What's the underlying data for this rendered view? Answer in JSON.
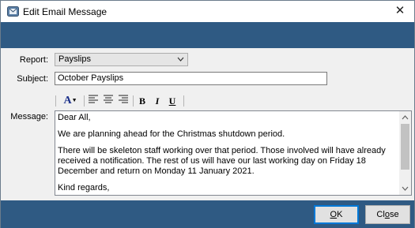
{
  "window": {
    "title": "Edit Email Message"
  },
  "form": {
    "report_label": "Report:",
    "report_value": "Payslips",
    "subject_label": "Subject:",
    "subject_value": "October Payslips",
    "message_label": "Message:"
  },
  "toolbar": {
    "font_color": "A",
    "bold": "B",
    "italic": "I",
    "underline": "U"
  },
  "message": {
    "line1": "Dear All,",
    "line2": "We are planning ahead for the Christmas shutdown period.",
    "line3": "There will be skeleton staff working over that period.  Those involved will have already received a notification.  The rest of us will have our last working day on Friday 18 December and return on Monday 11 January 2021.",
    "line4": "Kind regards,"
  },
  "buttons": {
    "ok_mnemonic": "O",
    "ok_rest": "K",
    "close_pre": "Cl",
    "close_mnemonic": "o",
    "close_post": "se"
  },
  "colors": {
    "band": "#2f5a83",
    "body": "#f0f0f0"
  },
  "icons": [
    "app-icon",
    "close-icon",
    "font-color-icon",
    "align-left-icon",
    "align-center-icon",
    "align-right-icon",
    "bold-icon",
    "italic-icon",
    "underline-icon"
  ]
}
